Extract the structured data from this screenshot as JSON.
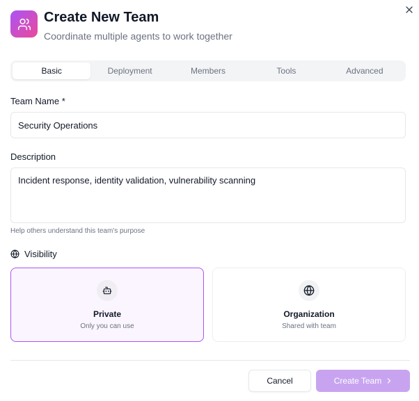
{
  "dialog": {
    "title": "Create New Team",
    "subtitle": "Coordinate multiple agents to work together",
    "icon": "users-icon",
    "accent": "#a855f7"
  },
  "tabs": [
    {
      "label": "Basic",
      "active": true
    },
    {
      "label": "Deployment",
      "active": false
    },
    {
      "label": "Members",
      "active": false
    },
    {
      "label": "Tools",
      "active": false
    },
    {
      "label": "Advanced",
      "active": false
    }
  ],
  "form": {
    "team_name_label": "Team Name *",
    "team_name_value": "Security Operations",
    "description_label": "Description",
    "description_value": "Incident response, identity validation, vulnerability scanning",
    "description_help": "Help others understand this team's purpose",
    "visibility_label": "Visibility"
  },
  "visibility_options": [
    {
      "title": "Private",
      "subtitle": "Only you can use",
      "icon": "bot-icon",
      "selected": true
    },
    {
      "title": "Organization",
      "subtitle": "Shared with team",
      "icon": "globe-icon",
      "selected": false
    }
  ],
  "footer": {
    "cancel_label": "Cancel",
    "create_label": "Create Team",
    "create_color": "#c8a4f0"
  }
}
